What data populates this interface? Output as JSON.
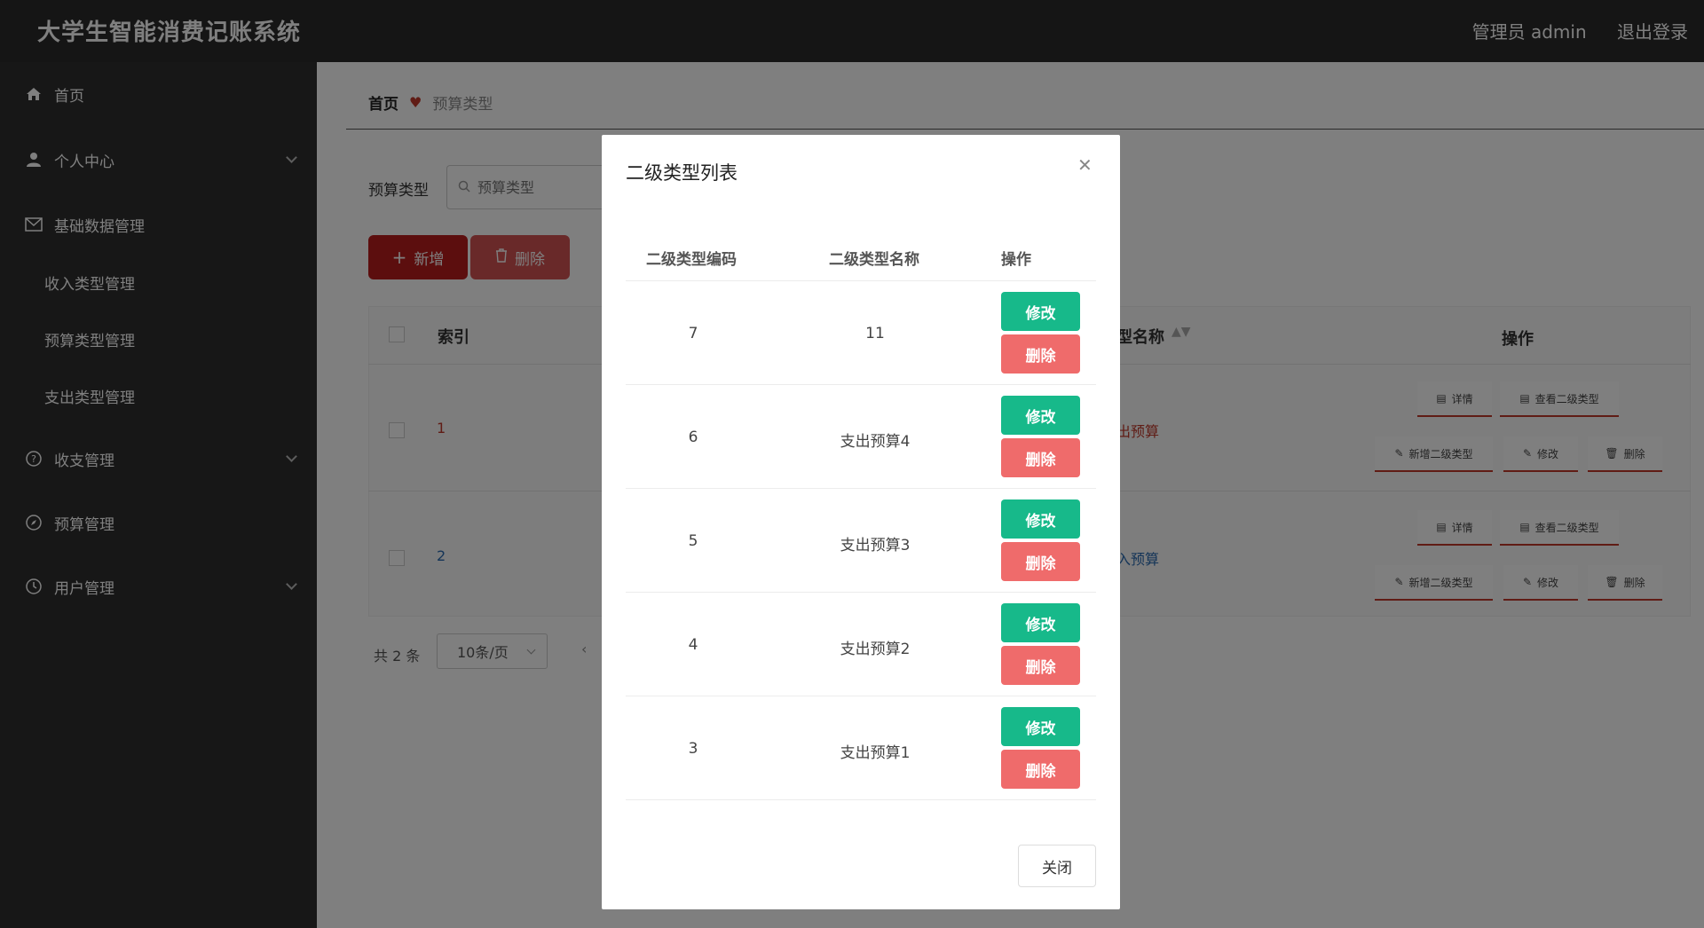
{
  "header": {
    "app_title": "大学生智能消费记账系统",
    "user_label": "管理员 admin",
    "logout_label": "退出登录"
  },
  "sidebar": {
    "items": [
      {
        "label": "首页",
        "icon": "home-icon"
      },
      {
        "label": "个人中心",
        "icon": "user-icon"
      },
      {
        "label": "基础数据管理",
        "icon": "mail-icon"
      },
      {
        "label": "收入类型管理"
      },
      {
        "label": "预算类型管理"
      },
      {
        "label": "支出类型管理"
      },
      {
        "label": "收支管理",
        "icon": "help-icon"
      },
      {
        "label": "预算管理",
        "icon": "compass-icon"
      },
      {
        "label": "用户管理",
        "icon": "clock-icon"
      }
    ]
  },
  "breadcrumb": {
    "home": "首页",
    "current": "预算类型"
  },
  "filter": {
    "label": "预算类型",
    "placeholder": "预算类型"
  },
  "toolbar": {
    "add_label": "新增",
    "delete_label": "删除"
  },
  "table": {
    "headers": {
      "index": "索引",
      "name": "型名称",
      "ops": "操作"
    },
    "rows": [
      {
        "index": "1",
        "name": "出预算"
      },
      {
        "index": "2",
        "name": "入预算"
      }
    ],
    "op_labels": {
      "detail": "详情",
      "view_sub": "查看二级类型",
      "add_sub": "新增二级类型",
      "edit": "修改",
      "delete": "删除"
    }
  },
  "pager": {
    "total": "共 2 条",
    "page_size": "10条/页"
  },
  "modal": {
    "title": "二级类型列表",
    "headers": {
      "code": "二级类型编码",
      "name": "二级类型名称",
      "ops": "操作"
    },
    "rows": [
      {
        "code": "7",
        "name": "11"
      },
      {
        "code": "6",
        "name": "支出预算4"
      },
      {
        "code": "5",
        "name": "支出预算3"
      },
      {
        "code": "4",
        "name": "支出预算2"
      },
      {
        "code": "3",
        "name": "支出预算1"
      }
    ],
    "edit_label": "修改",
    "delete_label": "删除",
    "close_label": "关闭"
  },
  "colors": {
    "header_bg": "#2b2b2b",
    "sidebar_bg": "#2e2e2e",
    "accent_red": "#b81c1c",
    "edit_green": "#17b98a",
    "delete_pink": "#ef6b6b"
  }
}
